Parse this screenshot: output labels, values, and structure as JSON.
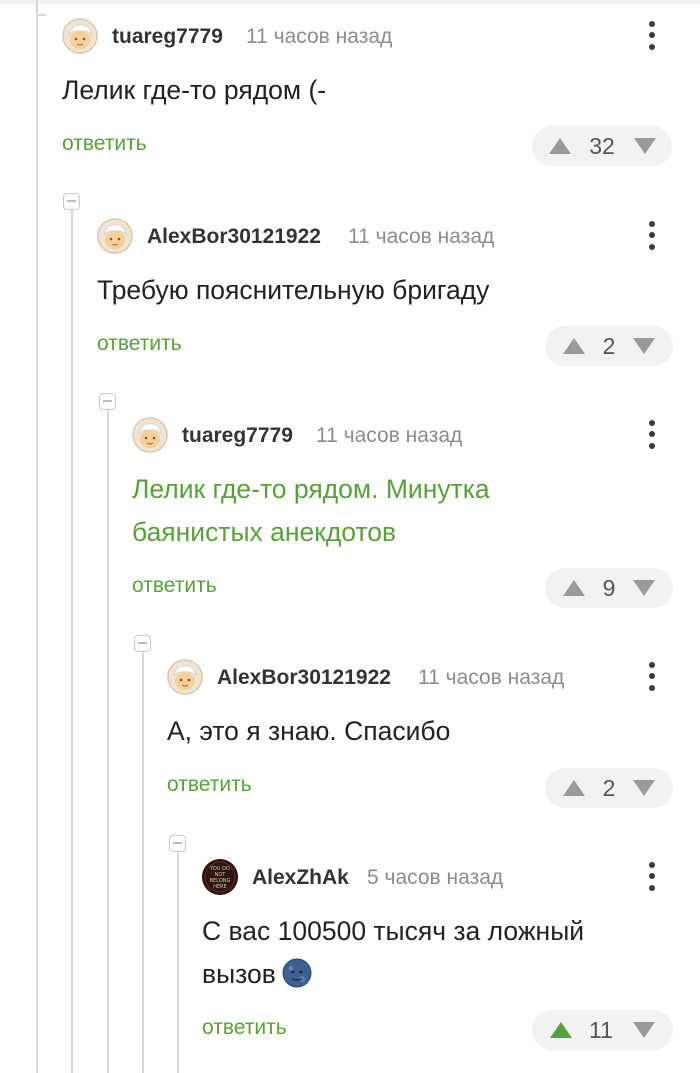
{
  "comments": [
    {
      "username": "tuareg7779",
      "time": "11 часов назад",
      "text": "Лелик где-то рядом (-",
      "reply": "ответить",
      "votes": "32",
      "avatar": "avatar-icon",
      "upvoted": false
    },
    {
      "username": "AlexBor30121922",
      "time": "11 часов назад",
      "text": "Требую пояснительную бригаду",
      "reply": "ответить",
      "votes": "2",
      "avatar": "avatar-icon",
      "upvoted": false
    },
    {
      "username": "tuareg7779",
      "time": "11 часов назад",
      "text_line1": "Лелик где-то рядом. Минутка",
      "text_line2": "баянистых анекдотов",
      "text_is_link": true,
      "reply": "ответить",
      "votes": "9",
      "avatar": "avatar-icon",
      "upvoted": false
    },
    {
      "username": "AlexBor30121922",
      "time": "11 часов назад",
      "text": "А, это я знаю. Спасибо",
      "reply": "ответить",
      "votes": "2",
      "avatar": "avatar-icon",
      "upvoted": false
    },
    {
      "username": "AlexZhAk",
      "time": "5 часов назад",
      "text_line1": "С вас 100500 тысяч за ложный",
      "text_line2": "вызов",
      "emoji": "new-moon-face-emoji",
      "reply": "ответить",
      "votes": "11",
      "avatar": "you-do-not-belong-here-avatar",
      "avatar_text": "YOU DO NOT BELONG HERE",
      "upvoted": true
    }
  ],
  "colors": {
    "accent_green": "#58a13a",
    "vote_bg": "#f2f2f2",
    "thread_line": "#d9d9d9",
    "vote_arrow": "#9a9a9a",
    "username": "#333333",
    "meta": "#8c8c8c"
  }
}
